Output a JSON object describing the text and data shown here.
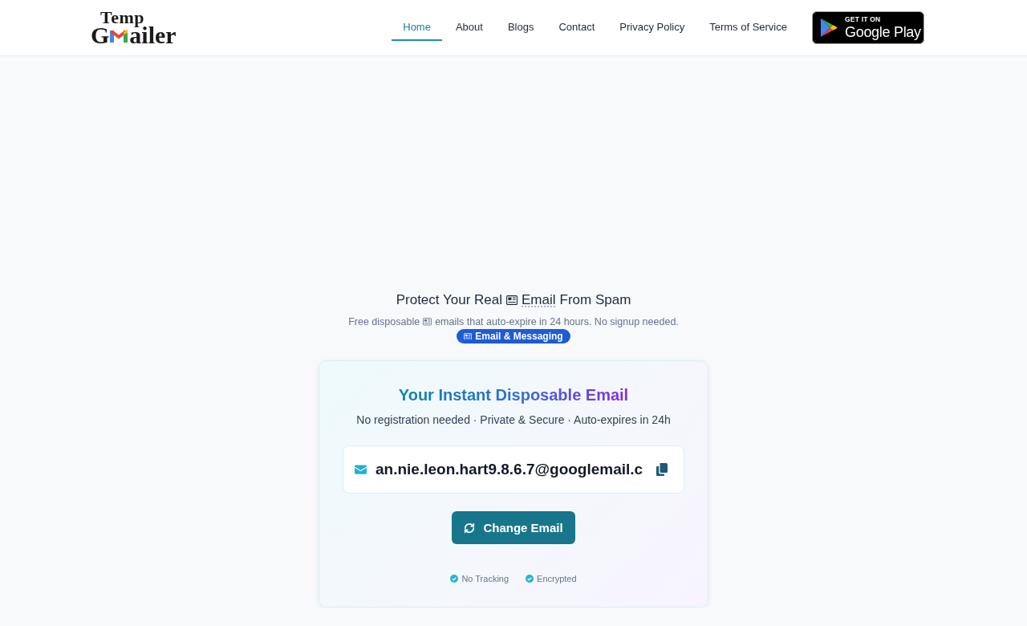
{
  "header": {
    "logo": {
      "top": "Temp",
      "first_letter": "G",
      "rest": "ailer"
    },
    "nav": [
      {
        "label": "Home",
        "selected": true
      },
      {
        "label": "About",
        "selected": false
      },
      {
        "label": "Blogs",
        "selected": false
      },
      {
        "label": "Contact",
        "selected": false
      },
      {
        "label": "Privacy Policy",
        "selected": false
      },
      {
        "label": "Terms of Service",
        "selected": false
      }
    ],
    "store_badge": {
      "caption": "GET IT ON",
      "store": "Google Play"
    }
  },
  "hero": {
    "heading": {
      "before": "Protect Your Real",
      "term": "Email",
      "after": "From Spam"
    },
    "subtitle": {
      "before": "Free disposable",
      "after": "emails that auto-expire in 24 hours. No signup needed."
    },
    "category_badge": "Email & Messaging"
  },
  "email_card": {
    "title": "Your Instant Disposable Email",
    "subtitle": "No registration needed · Private & Secure · Auto-expires in 24h",
    "email": "an.nie.leon.hart9.8.6.7@googlemail.c",
    "button": "Change Email",
    "features": [
      "No Tracking",
      "Encrypted"
    ]
  }
}
